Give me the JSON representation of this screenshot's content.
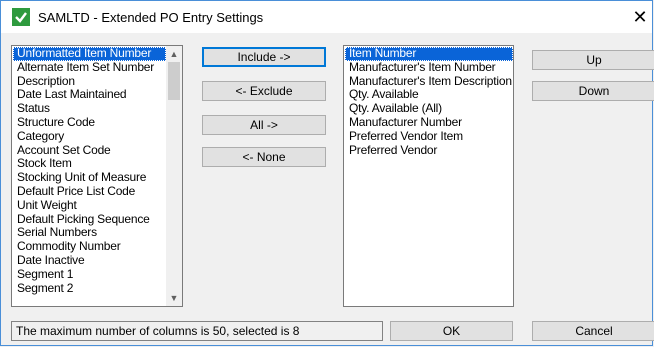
{
  "window": {
    "title": "SAMLTD - Extended PO Entry Settings",
    "close_glyph": "✕"
  },
  "available_list": {
    "items": [
      "Unformatted Item Number",
      "Alternate Item Set Number",
      "Description",
      "Date Last Maintained",
      "Status",
      "Structure Code",
      "Category",
      "Account Set Code",
      "Stock Item",
      "Stocking Unit of Measure",
      "Default Price List Code",
      "Unit Weight",
      "Default Picking Sequence",
      "Serial Numbers",
      "Commodity Number",
      "Date Inactive",
      "Segment 1",
      "Segment 2"
    ],
    "selected_index": 0
  },
  "selected_list": {
    "items": [
      "Item Number",
      "Manufacturer's Item Number",
      "Manufacturer's Item Description",
      "Qty. Available",
      "Qty. Available (All)",
      "Manufacturer Number",
      "Preferred Vendor Item",
      "Preferred Vendor"
    ],
    "selected_index": 0
  },
  "buttons": {
    "include": "Include ->",
    "exclude": "<- Exclude",
    "all": "All ->",
    "none": "<- None",
    "up": "Up",
    "down": "Down",
    "ok": "OK",
    "cancel": "Cancel"
  },
  "status": {
    "text": "The maximum number of columns is 50, selected is 8"
  },
  "colors": {
    "selection": "#0a64d8",
    "window_border": "#4a8fd8",
    "icon_green": "#2e9a3e"
  },
  "icons": {
    "app": "check-icon",
    "close": "close-icon",
    "scroll_up": "chevron-up-icon",
    "scroll_down": "chevron-down-icon"
  }
}
